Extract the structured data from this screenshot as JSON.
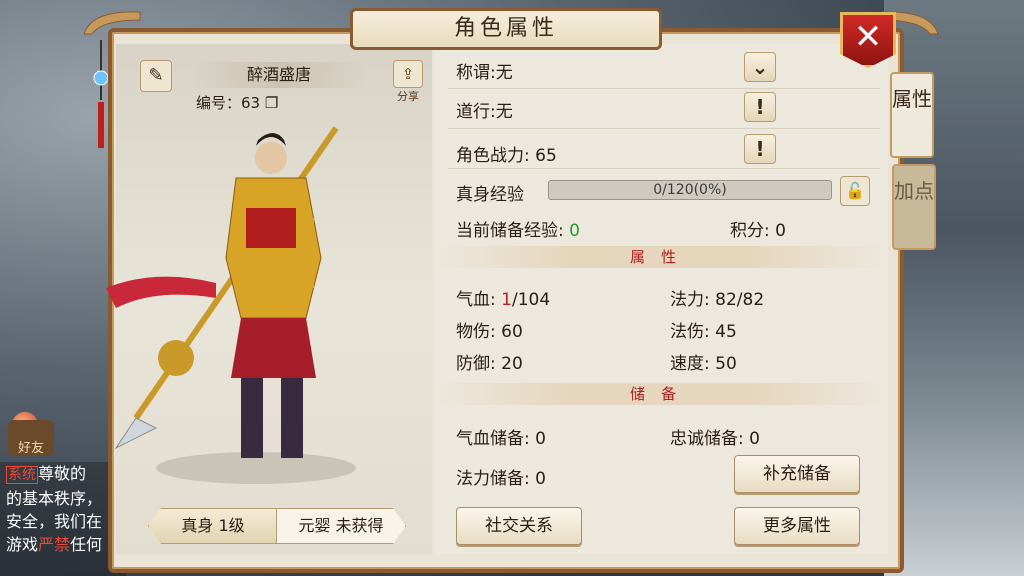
{
  "window": {
    "title": "角色属性"
  },
  "side_tabs": [
    {
      "label": "属性"
    },
    {
      "label": "加点"
    }
  ],
  "character": {
    "name": "醉酒盛唐",
    "id_label": "编号：",
    "id_value": "63",
    "share_label": "分享"
  },
  "level_tabs": [
    {
      "label": "真身 1级"
    },
    {
      "label": "元婴 未获得"
    }
  ],
  "info": {
    "title_label": "称谓:",
    "title_value": "无",
    "daoxing_label": "道行:",
    "daoxing_value": "无",
    "power_label": "角色战力:",
    "power_value": "65",
    "exp_label": "真身经验",
    "exp_text": "0/120(0%)",
    "exp_progress": 0,
    "stored_exp_label": "当前储备经验:",
    "stored_exp_value": "0",
    "points_label": "积分:",
    "points_value": "0"
  },
  "attributes": {
    "header": "属性",
    "hp_label": "气血:",
    "hp_current": "1",
    "hp_max": "/104",
    "mp_label": "法力:",
    "mp_value": "82/82",
    "phys_label": "物伤:",
    "phys_value": "60",
    "magic_label": "法伤:",
    "magic_value": "45",
    "def_label": "防御:",
    "def_value": "20",
    "speed_label": "速度:",
    "speed_value": "50"
  },
  "reserve": {
    "header": "储备",
    "hp_reserve_label": "气血储备:",
    "hp_reserve_value": "0",
    "loyalty_label": "忠诚储备:",
    "loyalty_value": "0",
    "mp_reserve_label": "法力储备:",
    "mp_reserve_value": "0",
    "refill_button": "补充储备"
  },
  "buttons": {
    "social": "社交关系",
    "more": "更多属性"
  },
  "chat": {
    "tag": "系统",
    "line1": "尊敬的",
    "line2": "的基本秩序，",
    "line3": "安全，我们在",
    "line4a": "游戏",
    "line4b": "严禁",
    "line4c": "任何"
  },
  "friend_button": "好友",
  "colors": {
    "accent_red": "#c02020",
    "frame_brown": "#8a5a33",
    "value_green": "#2a9a2a"
  }
}
